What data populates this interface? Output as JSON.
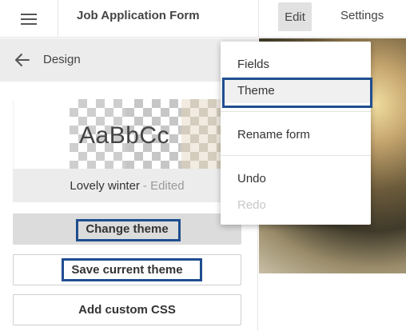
{
  "header": {
    "title": "Job Application Form",
    "tabs": {
      "edit": "Edit",
      "settings": "Settings"
    }
  },
  "icons": {
    "menu": "hamburger-icon",
    "back": "arrow-left-icon"
  },
  "panel": {
    "title": "Design",
    "preview": {
      "sample_text": "AaBbCc",
      "theme_name": "Lovely winter",
      "edited_suffix": "- Edited"
    },
    "buttons": {
      "change_theme": "Change theme",
      "save_theme": "Save current theme",
      "add_css": "Add custom CSS"
    }
  },
  "edit_menu": {
    "items": {
      "fields": "Fields",
      "theme": "Theme",
      "rename": "Rename form",
      "undo": "Undo",
      "redo": "Redo"
    },
    "redo_disabled": true,
    "hovered": "Theme"
  },
  "colors": {
    "highlight_border": "#1f4e8f",
    "active_tab_bg": "#e1e1e1",
    "panel_header_bg": "#ececec"
  }
}
